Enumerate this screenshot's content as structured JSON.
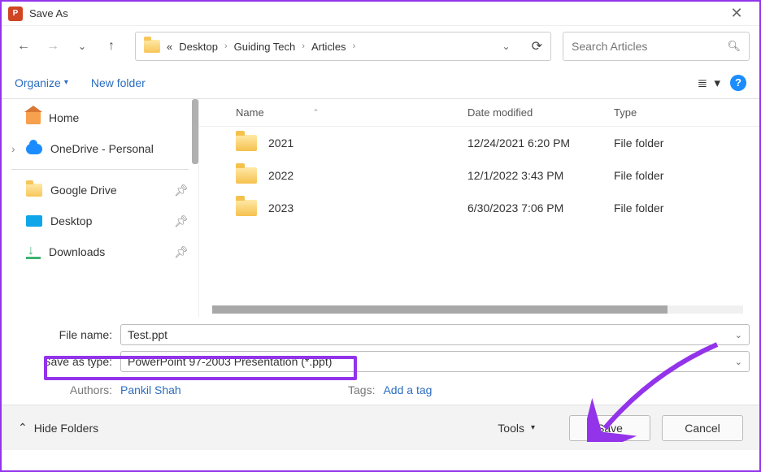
{
  "title": "Save As",
  "breadcrumb": {
    "sep1": "«",
    "p1": "Desktop",
    "p2": "Guiding Tech",
    "p3": "Articles"
  },
  "search": {
    "placeholder": "Search Articles"
  },
  "toolbar": {
    "organize": "Organize",
    "newfolder": "New folder"
  },
  "sidebar": {
    "home": "Home",
    "onedrive": "OneDrive - Personal",
    "gdrive": "Google Drive",
    "desktop": "Desktop",
    "downloads": "Downloads"
  },
  "columns": {
    "name": "Name",
    "date": "Date modified",
    "type": "Type"
  },
  "rows": [
    {
      "name": "2021",
      "date": "12/24/2021 6:20 PM",
      "type": "File folder"
    },
    {
      "name": "2022",
      "date": "12/1/2022 3:43 PM",
      "type": "File folder"
    },
    {
      "name": "2023",
      "date": "6/30/2023 7:06 PM",
      "type": "File folder"
    }
  ],
  "form": {
    "filename_lbl": "File name:",
    "filename_val": "Test.ppt",
    "savetype_lbl": "Save as type:",
    "savetype_val": "PowerPoint 97-2003 Presentation (*.ppt)"
  },
  "meta": {
    "authors_lbl": "Authors:",
    "authors_val": "Pankil Shah",
    "tags_lbl": "Tags:",
    "tags_val": "Add a tag"
  },
  "footer": {
    "hide": "Hide Folders",
    "tools": "Tools",
    "save": "Save",
    "cancel": "Cancel"
  }
}
